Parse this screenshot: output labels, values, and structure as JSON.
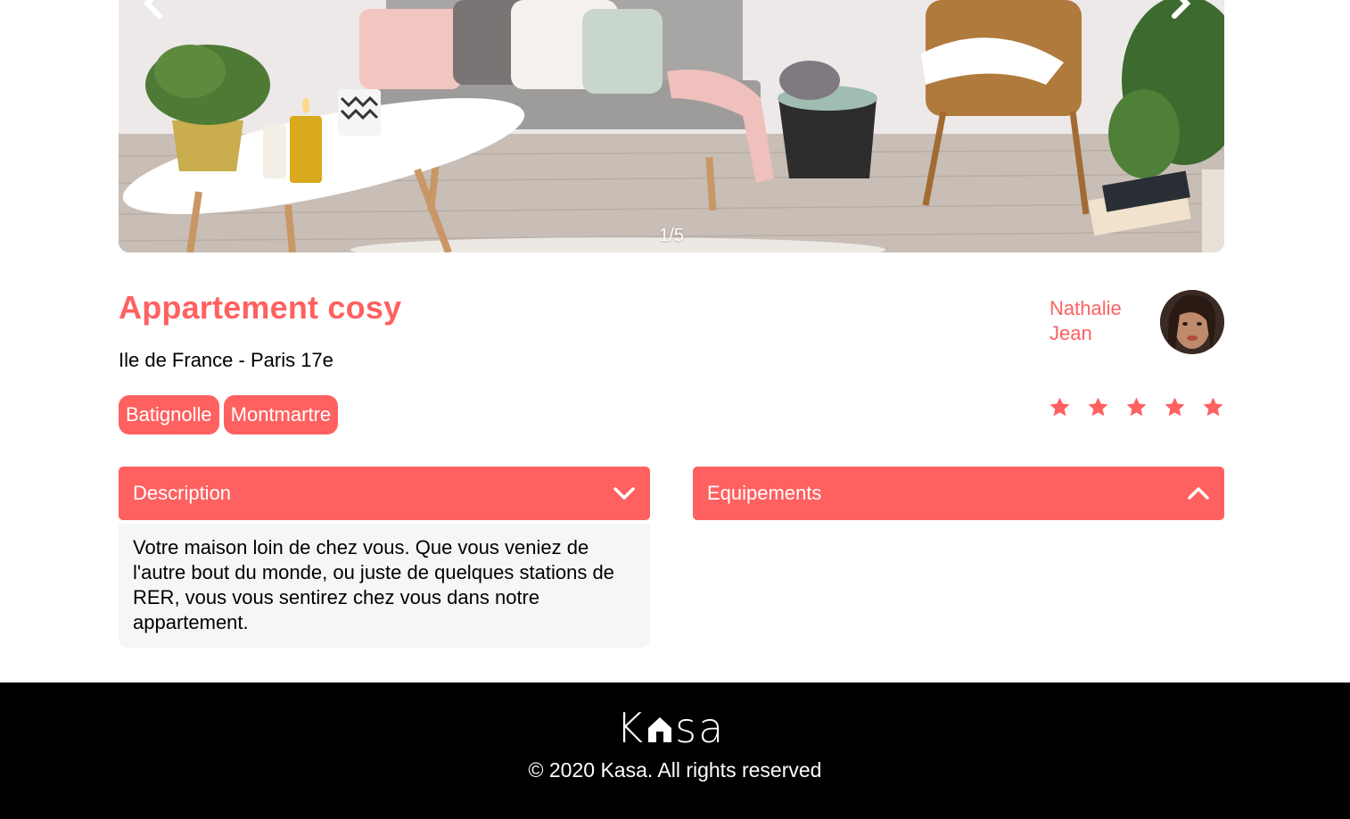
{
  "gallery": {
    "counter": "1/5",
    "prev_icon": "chevron-left-icon",
    "next_icon": "chevron-right-icon"
  },
  "listing": {
    "title": "Appartement cosy",
    "location": "Ile de France - Paris 17e",
    "tags": [
      "Batignolle",
      "Montmartre"
    ],
    "rating": 5,
    "rating_max": 5
  },
  "host": {
    "first_name": "Nathalie",
    "last_name": "Jean"
  },
  "collapses": {
    "description": {
      "label": "Description",
      "open": true,
      "text": "Votre maison loin de chez vous. Que vous veniez de l'autre bout du monde, ou juste de quelques stations de RER, vous vous sentirez chez vous dans notre appartement."
    },
    "equipments": {
      "label": "Equipements",
      "open": false
    }
  },
  "footer": {
    "logo_left": "K",
    "logo_right": "sa",
    "copyright": "© 2020 Kasa. All rights reserved"
  },
  "colors": {
    "accent": "#FF6060",
    "panel_bg": "#F6F6F6",
    "footer_bg": "#000000",
    "text": "#000000"
  }
}
